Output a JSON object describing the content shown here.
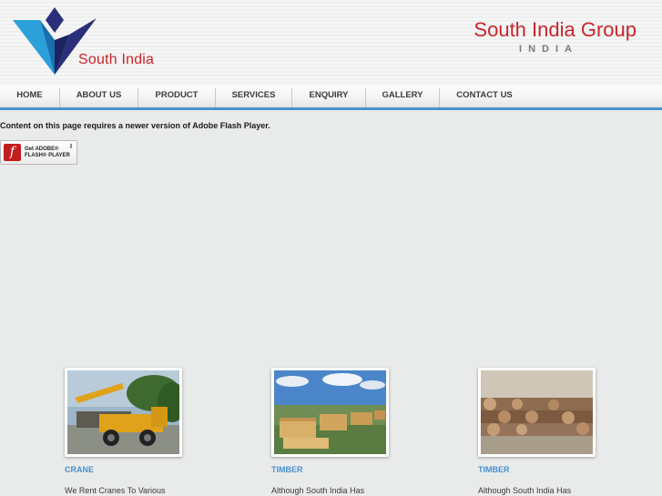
{
  "header": {
    "logo_text": "South India",
    "brand_title": "South India Group",
    "brand_subtitle": "INDIA"
  },
  "nav": {
    "items": [
      {
        "label": "HOME"
      },
      {
        "label": "ABOUT US"
      },
      {
        "label": "PRODUCT"
      },
      {
        "label": "SERVICES"
      },
      {
        "label": "ENQUIRY"
      },
      {
        "label": "GALLERY"
      },
      {
        "label": "CONTACT US"
      }
    ],
    "accent_color": "#4a90d0"
  },
  "flash": {
    "message": "Content on this page requires a newer version of Adobe Flash Player.",
    "badge_get": "Get ADOBE®",
    "badge_product": "FLASH® PLAYER"
  },
  "cards": [
    {
      "title": "CRANE",
      "text": "We Rent Cranes To Various",
      "image": "crane-photo"
    },
    {
      "title": "TIMBER",
      "text": "Although South India Has",
      "image": "timber-yard-photo"
    },
    {
      "title": "TIMBER",
      "text": "Although South India Has",
      "image": "logs-photo"
    }
  ],
  "colors": {
    "brand_red": "#c8252c",
    "link_blue": "#4a90d0",
    "page_bg": "#e9ebea"
  }
}
